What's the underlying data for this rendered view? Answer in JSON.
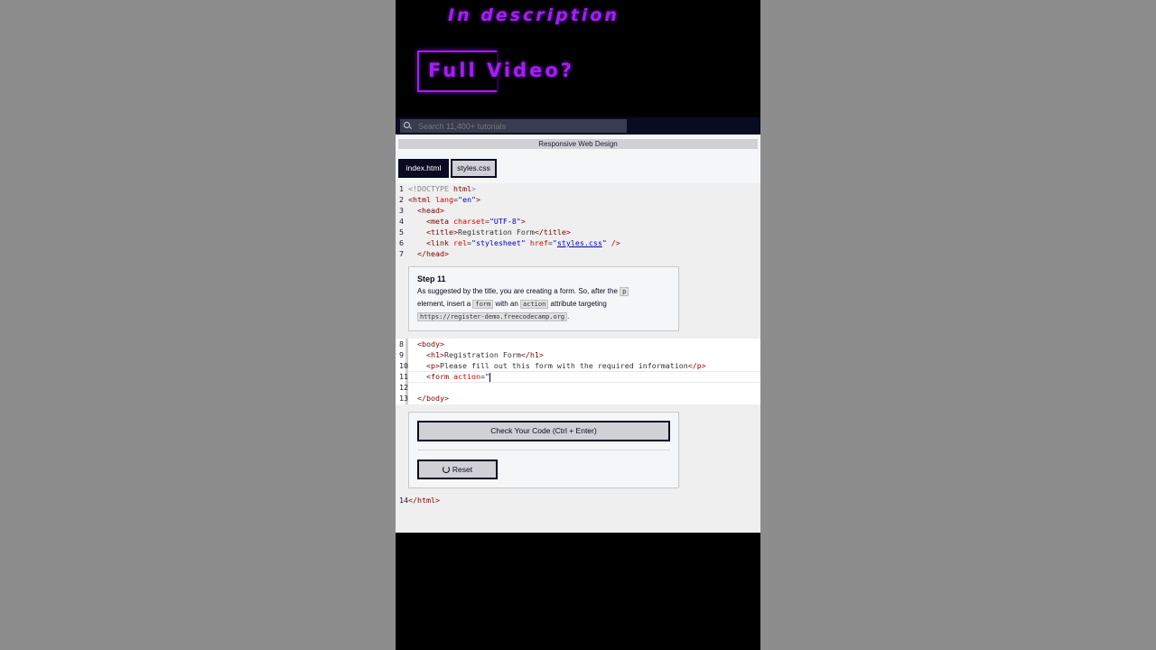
{
  "promo": {
    "line1": "In description",
    "line2": "Full Video?"
  },
  "navbar": {
    "search_placeholder": "Search 11,400+ tutorials",
    "search_icon": "search-icon"
  },
  "breadcrumb": "Responsive Web Design",
  "tabs": [
    {
      "label": "index.html",
      "active": true
    },
    {
      "label": "styles.css",
      "active": false
    }
  ],
  "code_top": [
    {
      "n": "1",
      "segs": [
        {
          "c": "g",
          "t": "<!DOCTYPE "
        },
        {
          "c": "t",
          "t": "html"
        },
        {
          "c": "g",
          "t": ">"
        }
      ]
    },
    {
      "n": "2",
      "segs": [
        {
          "c": "t",
          "t": "<html "
        },
        {
          "c": "a",
          "t": "lang"
        },
        {
          "c": "",
          "t": "="
        },
        {
          "c": "v",
          "t": "\"en\""
        },
        {
          "c": "t",
          "t": ">"
        }
      ]
    },
    {
      "n": "3",
      "segs": [
        {
          "c": "",
          "t": "  "
        },
        {
          "c": "t",
          "t": "<head>"
        }
      ]
    },
    {
      "n": "4",
      "segs": [
        {
          "c": "",
          "t": "    "
        },
        {
          "c": "t",
          "t": "<meta "
        },
        {
          "c": "a",
          "t": "charset"
        },
        {
          "c": "",
          "t": "="
        },
        {
          "c": "v",
          "t": "\"UTF-8\""
        },
        {
          "c": "t",
          "t": ">"
        }
      ]
    },
    {
      "n": "5",
      "segs": [
        {
          "c": "",
          "t": "    "
        },
        {
          "c": "t",
          "t": "<title>"
        },
        {
          "c": "",
          "t": "Registration Form"
        },
        {
          "c": "t",
          "t": "</title>"
        }
      ]
    },
    {
      "n": "6",
      "segs": [
        {
          "c": "",
          "t": "    "
        },
        {
          "c": "t",
          "t": "<link "
        },
        {
          "c": "a",
          "t": "rel"
        },
        {
          "c": "",
          "t": "="
        },
        {
          "c": "v",
          "t": "\"stylesheet\" "
        },
        {
          "c": "a",
          "t": "href"
        },
        {
          "c": "",
          "t": "="
        },
        {
          "c": "v",
          "t": "\""
        },
        {
          "c": "lk",
          "t": "styles.css"
        },
        {
          "c": "v",
          "t": "\" "
        },
        {
          "c": "t",
          "t": "/>"
        }
      ]
    },
    {
      "n": "7",
      "segs": [
        {
          "c": "",
          "t": "  "
        },
        {
          "c": "t",
          "t": "</head>"
        }
      ]
    }
  ],
  "step": {
    "title": "Step 11",
    "text_1": "As suggested by the title, you are creating a form. So, after the ",
    "code_p": "p",
    "text_2": "element, insert a ",
    "code_form": "form",
    "text_3": " with an ",
    "code_action": "action",
    "text_4": " attribute targeting",
    "code_url": "https://register-demo.freecodecamp.org",
    "text_5": "."
  },
  "code_edit": [
    {
      "n": "8",
      "segs": [
        {
          "c": "",
          "t": "  "
        },
        {
          "c": "t",
          "t": "<body>"
        }
      ]
    },
    {
      "n": "9",
      "segs": [
        {
          "c": "",
          "t": "    "
        },
        {
          "c": "t",
          "t": "<h1>"
        },
        {
          "c": "",
          "t": "Registration Form"
        },
        {
          "c": "t",
          "t": "</h1>"
        }
      ]
    },
    {
      "n": "10",
      "segs": [
        {
          "c": "",
          "t": "    "
        },
        {
          "c": "t",
          "t": "<p>"
        },
        {
          "c": "",
          "t": "Please fill out this form with the required information"
        },
        {
          "c": "t",
          "t": "</p>"
        }
      ]
    },
    {
      "n": "11",
      "segs": [
        {
          "c": "",
          "t": "    "
        },
        {
          "c": "t",
          "t": "<form "
        },
        {
          "c": "a",
          "t": "action"
        },
        {
          "c": "",
          "t": "="
        },
        {
          "c": "v",
          "t": "\""
        }
      ],
      "caret": true
    },
    {
      "n": "12",
      "segs": []
    },
    {
      "n": "13",
      "segs": [
        {
          "c": "",
          "t": "  "
        },
        {
          "c": "t",
          "t": "</body>"
        }
      ]
    }
  ],
  "buttons": {
    "check": "Check Your Code (Ctrl + Enter)",
    "reset": "Reset",
    "reset_icon": "reset-icon"
  },
  "code_bottom": [
    {
      "n": "14",
      "segs": [
        {
          "c": "t",
          "t": "</html>"
        }
      ]
    }
  ]
}
